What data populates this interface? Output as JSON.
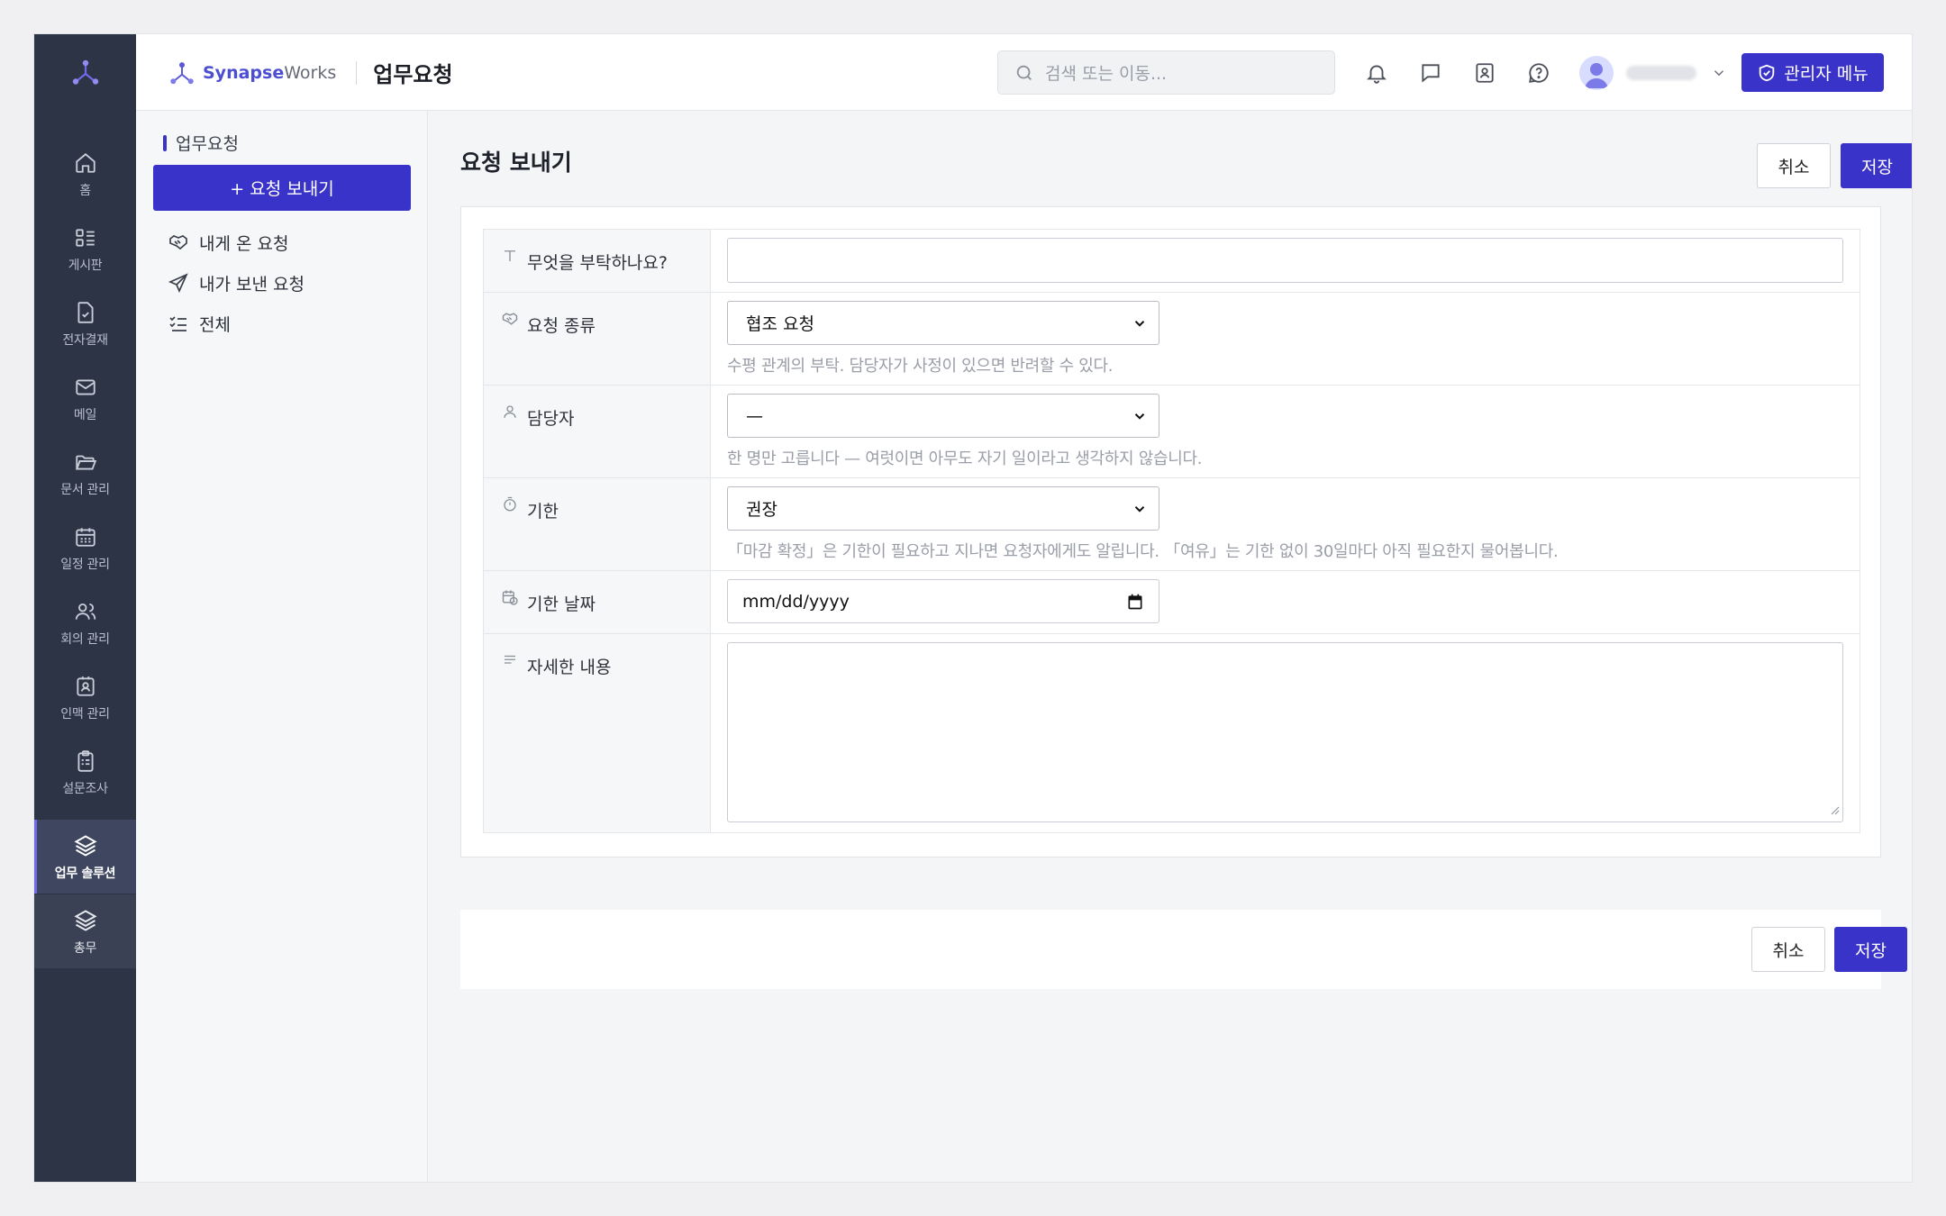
{
  "rail": {
    "items": [
      {
        "label": "홈",
        "icon": "home-icon"
      },
      {
        "label": "게시판",
        "icon": "board-icon"
      },
      {
        "label": "전자결재",
        "icon": "approval-icon"
      },
      {
        "label": "메일",
        "icon": "mail-icon"
      },
      {
        "label": "문서 관리",
        "icon": "folder-icon"
      },
      {
        "label": "일정 관리",
        "icon": "calendar-icon"
      },
      {
        "label": "회의 관리",
        "icon": "users-icon"
      },
      {
        "label": "인맥 관리",
        "icon": "contact-icon"
      },
      {
        "label": "설문조사",
        "icon": "clipboard-icon"
      },
      {
        "label": "업무 솔루션",
        "icon": "layers-icon"
      },
      {
        "label": "총무",
        "icon": "layers-icon"
      }
    ]
  },
  "header": {
    "brand_strong": "Synapse",
    "brand_light": "Works",
    "page_title": "업무요청",
    "search_placeholder": "검색 또는 이동...",
    "admin_label": "관리자 메뉴"
  },
  "subnav": {
    "section_title": "업무요청",
    "new_button": "+ 요청 보내기",
    "items": [
      {
        "label": "내게 온 요청",
        "icon": "handshake-icon"
      },
      {
        "label": "내가 보낸 요청",
        "icon": "send-icon"
      },
      {
        "label": "전체",
        "icon": "checklist-icon"
      }
    ]
  },
  "main": {
    "title": "요청 보내기",
    "cancel_label": "취소",
    "save_label": "저장",
    "form": {
      "subject_label": "무엇을 부탁하나요?",
      "subject_value": "",
      "type_label": "요청 종류",
      "type_value": "협조 요청",
      "type_hint": "수평 관계의 부탁. 담당자가 사정이 있으면 반려할 수 있다.",
      "assignee_label": "담당자",
      "assignee_value": "—",
      "assignee_hint": "한 명만 고릅니다 — 여럿이면 아무도 자기 일이라고 생각하지 않습니다.",
      "deadline_label": "기한",
      "deadline_value": "권장",
      "deadline_hint": "「마감 확정」은 기한이 필요하고 지나면 요청자에게도 알립니다. 「여유」는 기한 없이 30일마다 아직 필요한지 물어봅니다.",
      "date_label": "기한 날짜",
      "date_placeholder": "mm/dd/yyyy",
      "detail_label": "자세한 내용"
    }
  },
  "colors": {
    "accent": "#3a33c9",
    "rail_bg": "#2d3446"
  }
}
